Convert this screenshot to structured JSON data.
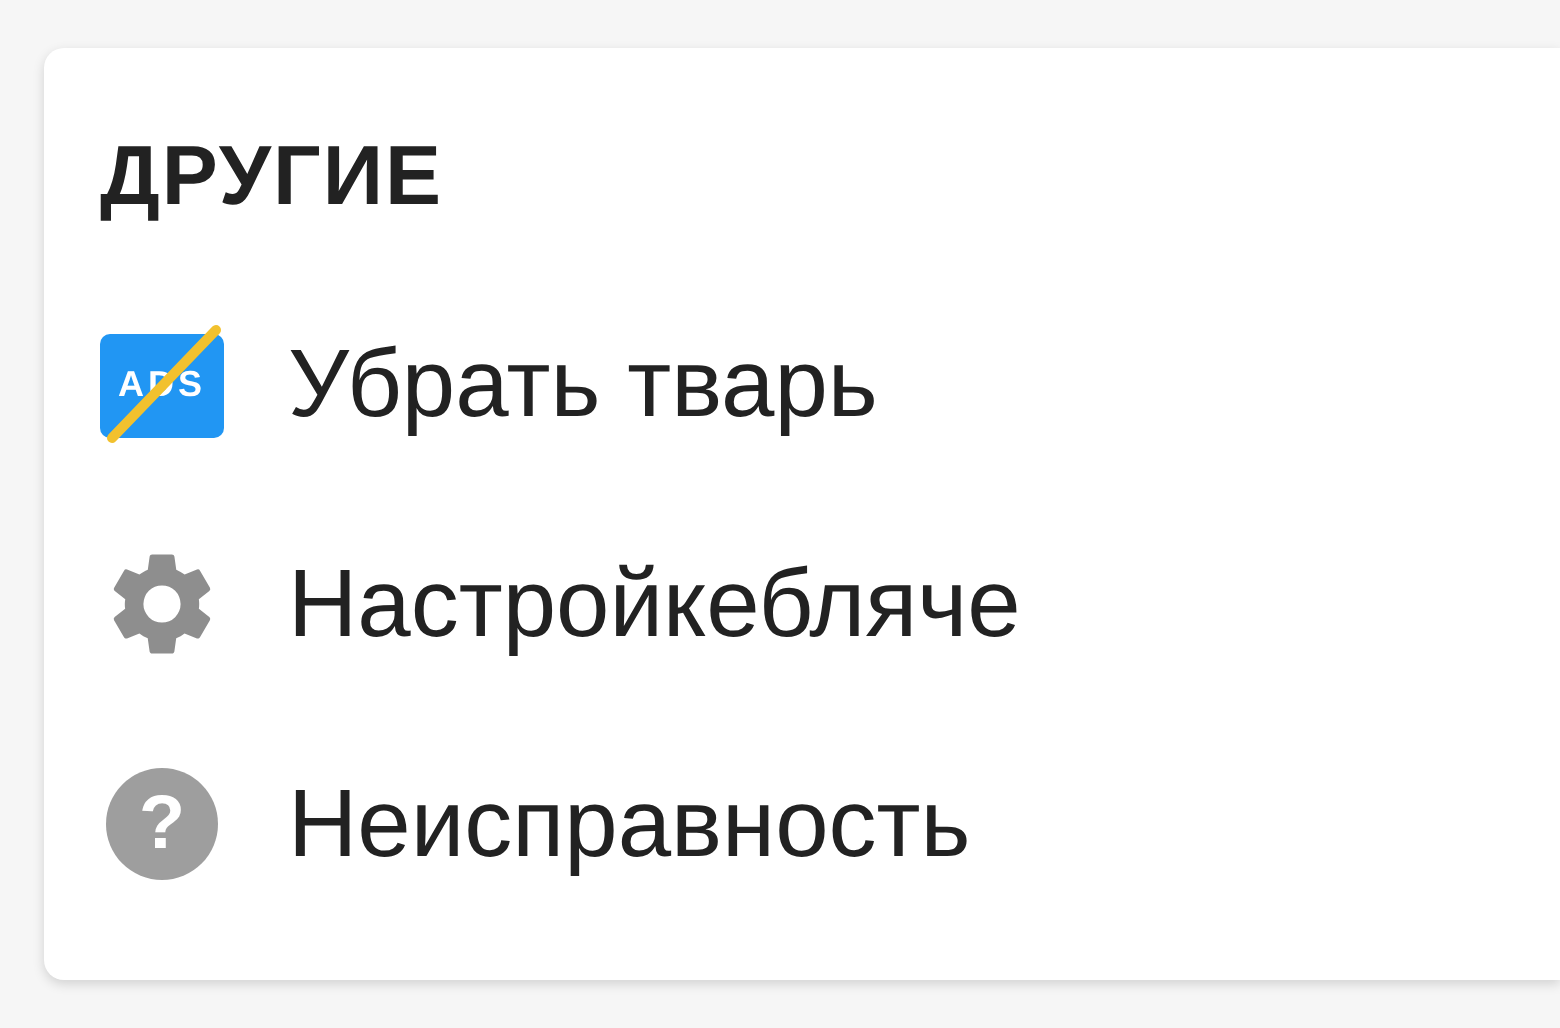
{
  "section": {
    "title": "ДРУГИЕ",
    "items": [
      {
        "kind": "ads",
        "label": "Убрать тварь",
        "icon_text": "ADS"
      },
      {
        "kind": "settings",
        "label": "Настройкебляче"
      },
      {
        "kind": "help",
        "label": "Неисправность",
        "icon_text": "?"
      }
    ]
  }
}
